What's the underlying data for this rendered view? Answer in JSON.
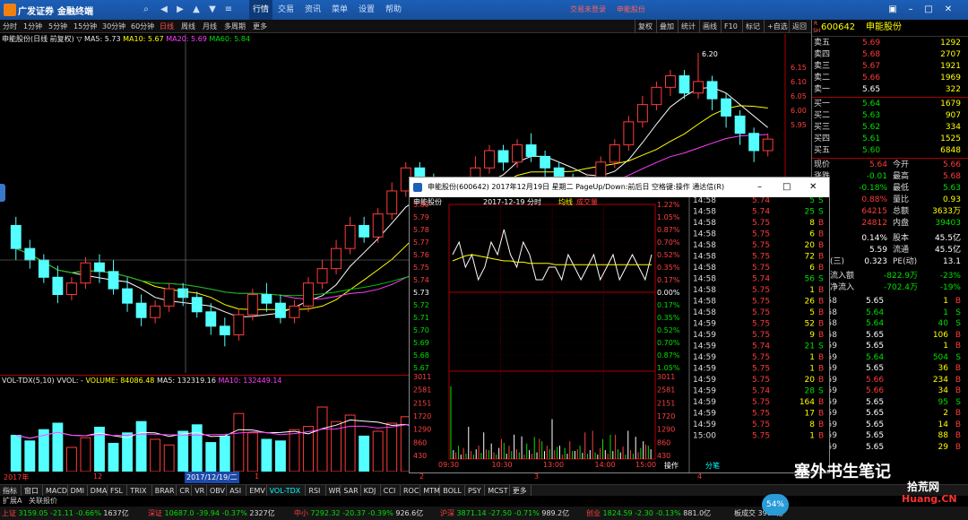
{
  "titlebar": {
    "brand": "广发证券",
    "subtitle": "金融终端",
    "menu": [
      "行情",
      "交易",
      "资讯",
      "菜单",
      "设置",
      "帮助"
    ],
    "active_menu": "行情",
    "login_msg": "交易未登录",
    "stock": "申能股份"
  },
  "periods": [
    "分时",
    "1分钟",
    "5分钟",
    "15分钟",
    "30分钟",
    "60分钟",
    "日线",
    "周线",
    "月线",
    "多周期",
    "更多"
  ],
  "selected_period": "日线",
  "right_tools": [
    "复权",
    "叠加",
    "统计",
    "画线",
    "F10",
    "标记",
    "+自选",
    "返回"
  ],
  "kline": {
    "title": "申能股份(日线 前复权)",
    "ma5": "MA5: 5.73",
    "ma10": "MA10: 5.67",
    "ma20": "MA20: 5.69",
    "ma60": "MA60: 5.84",
    "peak_label": "6.20",
    "price_ticks": [
      "6.15",
      "6.10",
      "6.05",
      "6.00",
      "5.95"
    ]
  },
  "volume": {
    "indicator": "VOL-TDX(5,10)",
    "vvol": "VVOL: -",
    "volume": "VOLUME: 84086.48",
    "ma5": "MA5: 132319.16",
    "ma10": "MA10: 132449.14"
  },
  "datebar": {
    "labels": [
      "2017年",
      "12",
      "2017/12/19/二",
      "1",
      "2",
      "3",
      "4"
    ]
  },
  "quote": {
    "code": "600642",
    "name": "申能股份",
    "tag_top": "R",
    "tag_bottom": "SH",
    "asks": [
      {
        "label": "卖五",
        "price": "5.69",
        "vol": "1292"
      },
      {
        "label": "卖四",
        "price": "5.68",
        "vol": "2707"
      },
      {
        "label": "卖三",
        "price": "5.67",
        "vol": "1921"
      },
      {
        "label": "卖二",
        "price": "5.66",
        "vol": "1969"
      },
      {
        "label": "卖一",
        "price": "5.65",
        "vol": "322"
      }
    ],
    "bids": [
      {
        "label": "买一",
        "price": "5.64",
        "vol": "1679"
      },
      {
        "label": "买二",
        "price": "5.63",
        "vol": "907"
      },
      {
        "label": "买三",
        "price": "5.62",
        "vol": "334"
      },
      {
        "label": "买四",
        "price": "5.61",
        "vol": "1525"
      },
      {
        "label": "买五",
        "price": "5.60",
        "vol": "6848"
      }
    ],
    "stats": [
      {
        "l1": "现价",
        "v1": "5.64",
        "l2": "今开",
        "v2": "5.66"
      },
      {
        "l1": "涨跌",
        "v1": "-0.01",
        "l2": "最高",
        "v2": "5.68"
      },
      {
        "l1": "涨幅",
        "v1": "-0.18%",
        "l2": "最低",
        "v2": "5.63"
      },
      {
        "l1": "振幅",
        "v1": "0.88%",
        "l2": "量比",
        "v2": "0.93"
      },
      {
        "l1": "总手",
        "v1": "64215",
        "l2": "总额",
        "v2": "3633万"
      },
      {
        "l1": "外盘",
        "v1": "24812",
        "l2": "内盘",
        "v2": "39403"
      }
    ],
    "stats2": [
      {
        "l1": "换手",
        "v1": "0.14%",
        "l2": "股本",
        "v2": "45.5亿"
      },
      {
        "l1": "净资",
        "v1": "5.59",
        "l2": "流通",
        "v2": "45.5亿"
      },
      {
        "l1": "收益(三)",
        "v1": "0.323",
        "l2": "PE(动)",
        "v2": "13.1"
      }
    ],
    "flows": [
      {
        "label": "主力流入额",
        "v": "-822.9万",
        "p": "-23%"
      },
      {
        "label": "主力净流入",
        "v": "-702.4万",
        "p": "-19%"
      }
    ],
    "ticks": [
      {
        "t": "14:58",
        "p": "5.65",
        "v": "1",
        "d": "B"
      },
      {
        "t": "14:58",
        "p": "5.64",
        "v": "1",
        "d": "S"
      },
      {
        "t": "14:58",
        "p": "5.64",
        "v": "40",
        "d": "S"
      },
      {
        "t": "14:58",
        "p": "5.65",
        "v": "106",
        "d": "B"
      },
      {
        "t": "14:59",
        "p": "5.65",
        "v": "1",
        "d": "B"
      },
      {
        "t": "14:59",
        "p": "5.64",
        "v": "504",
        "d": "S"
      },
      {
        "t": "14:59",
        "p": "5.65",
        "v": "36",
        "d": "B"
      },
      {
        "t": "14:59",
        "p": "5.66",
        "v": "234",
        "d": "B"
      },
      {
        "t": "14:59",
        "p": "5.66",
        "v": "34",
        "d": "B"
      },
      {
        "t": "14:59",
        "p": "5.65",
        "v": "95",
        "d": "S"
      },
      {
        "t": "14:59",
        "p": "5.65",
        "v": "2",
        "d": "B"
      },
      {
        "t": "14:59",
        "p": "5.65",
        "v": "14",
        "d": "B"
      },
      {
        "t": "14:59",
        "p": "5.65",
        "v": "88",
        "d": "B"
      },
      {
        "t": "14:59",
        "p": "5.65",
        "v": "29",
        "d": "B"
      }
    ]
  },
  "popup": {
    "title": "申能股份(600642) 2017年12月19日 星期二 PageUp/Down:前后日 空格键:操作 通达信(R)",
    "chart_title": "申能股份",
    "chart_date": "2017-12-19 分时",
    "legend_avg": "均线",
    "legend_vol": "成交量",
    "price_ticks": [
      "5.80",
      "5.79",
      "5.78",
      "5.77",
      "5.76",
      "5.75",
      "5.74",
      "5.73",
      "5.72",
      "5.71",
      "5.70",
      "5.69",
      "5.68",
      "5.67"
    ],
    "pct_ticks": [
      "1.22%",
      "1.05%",
      "0.87%",
      "0.70%",
      "0.52%",
      "0.35%",
      "0.17%",
      "0.00%",
      "0.17%",
      "0.35%",
      "0.52%",
      "0.70%",
      "0.87%",
      "1.05%"
    ],
    "vol_ticks": [
      "3011",
      "2581",
      "2151",
      "1720",
      "1290",
      "860",
      "430"
    ],
    "time_ticks": [
      "09:30",
      "10:30",
      "13:00",
      "14:00",
      "15:00"
    ],
    "bottom_buttons": [
      "操作",
      "分笔"
    ],
    "ticks": [
      {
        "t": "14:58",
        "p": "5.74",
        "v": "5",
        "d": "S"
      },
      {
        "t": "14:58",
        "p": "5.74",
        "v": "25",
        "d": "S"
      },
      {
        "t": "14:58",
        "p": "5.75",
        "v": "8",
        "d": "B"
      },
      {
        "t": "14:58",
        "p": "5.75",
        "v": "6",
        "d": "B"
      },
      {
        "t": "14:58",
        "p": "5.75",
        "v": "20",
        "d": "B"
      },
      {
        "t": "14:58",
        "p": "5.75",
        "v": "72",
        "d": "B"
      },
      {
        "t": "14:58",
        "p": "5.75",
        "v": "6",
        "d": "B"
      },
      {
        "t": "14:58",
        "p": "5.74",
        "v": "56",
        "d": "S"
      },
      {
        "t": "14:58",
        "p": "5.75",
        "v": "1",
        "d": "B"
      },
      {
        "t": "14:58",
        "p": "5.75",
        "v": "26",
        "d": "B"
      },
      {
        "t": "14:58",
        "p": "5.75",
        "v": "5",
        "d": "B"
      },
      {
        "t": "14:59",
        "p": "5.75",
        "v": "52",
        "d": "B"
      },
      {
        "t": "14:59",
        "p": "5.75",
        "v": "9",
        "d": "B"
      },
      {
        "t": "14:59",
        "p": "5.74",
        "v": "21",
        "d": "S"
      },
      {
        "t": "14:59",
        "p": "5.75",
        "v": "1",
        "d": "B"
      },
      {
        "t": "14:59",
        "p": "5.75",
        "v": "1",
        "d": "B"
      },
      {
        "t": "14:59",
        "p": "5.75",
        "v": "20",
        "d": "B"
      },
      {
        "t": "14:59",
        "p": "5.74",
        "v": "28",
        "d": "S"
      },
      {
        "t": "14:59",
        "p": "5.75",
        "v": "164",
        "d": "B"
      },
      {
        "t": "14:59",
        "p": "5.75",
        "v": "17",
        "d": "B"
      },
      {
        "t": "14:59",
        "p": "5.75",
        "v": "8",
        "d": "B"
      },
      {
        "t": "15:00",
        "p": "5.75",
        "v": "1",
        "d": "B"
      }
    ]
  },
  "tabs": [
    "指标",
    "窗口",
    "MACD",
    "DMI",
    "DMA",
    "FSL",
    "TRIX",
    "BRAR",
    "CR",
    "VR",
    "OBV",
    "ASI",
    "EMV",
    "VOL-TDX",
    "RSI",
    "WR",
    "SAR",
    "KDJ",
    "CCI",
    "ROC",
    "MTM",
    "BOLL",
    "PSY",
    "MCST",
    "更多"
  ],
  "selected_tab": "VOL-TDX",
  "expand": [
    "扩展A",
    "关联报价"
  ],
  "status": [
    {
      "name": "上证",
      "v": "3159.05",
      "c": "-21.11",
      "p": "-0.66%",
      "a": "1637亿"
    },
    {
      "name": "深证",
      "v": "10687.0",
      "c": "-39.94",
      "p": "-0.37%",
      "a": "2327亿"
    },
    {
      "name": "中小",
      "v": "7292.32",
      "c": "-20.37",
      "p": "-0.39%",
      "a": "926.6亿"
    },
    {
      "name": "沪深",
      "v": "3871.14",
      "c": "-27.50",
      "p": "-0.71%",
      "a": "989.2亿"
    },
    {
      "name": "创业",
      "v": "1824.59",
      "c": "-2.30",
      "p": "-0.13%",
      "a": "881.0亿"
    }
  ],
  "status_tail": {
    "label": "板成交",
    "value": "3964亿",
    "badge": "54%"
  },
  "watermark": {
    "line1": "塞外书生笔记",
    "line2": "拾荒网",
    "line3": "Huang.CN"
  },
  "popup_chart_data": {
    "type": "line",
    "x": [
      "09:30",
      "10:30",
      "13:00",
      "14:00",
      "15:00"
    ],
    "series": [
      {
        "values": [
          5.76,
          5.77,
          5.75,
          5.76,
          5.74,
          5.75,
          5.77,
          5.76,
          5.78,
          5.76,
          5.75,
          5.77,
          5.76,
          5.74,
          5.74,
          5.75,
          5.75,
          5.74,
          5.76,
          5.75,
          5.74,
          5.75,
          5.76,
          5.74,
          5.75,
          5.76,
          5.74,
          5.75,
          5.76,
          5.75,
          5.74,
          5.76
        ]
      },
      {
        "values": [
          5.755,
          5.757,
          5.759,
          5.76,
          5.759,
          5.758,
          5.757,
          5.756,
          5.755,
          5.755,
          5.754,
          5.754,
          5.753,
          5.753,
          5.753,
          5.753,
          5.752,
          5.752,
          5.752,
          5.752,
          5.752,
          5.752,
          5.752,
          5.752,
          5.752,
          5.752,
          5.752,
          5.752,
          5.752,
          5.752,
          5.752,
          5.752
        ]
      }
    ],
    "ylim": [
      5.67,
      5.8
    ],
    "base": 5.73
  },
  "chart_data": {
    "type": "candlestick",
    "ylim": [
      5.1,
      6.24
    ],
    "candles": [
      [
        5.6,
        5.52,
        5.63,
        5.48
      ],
      [
        5.52,
        5.48,
        5.55,
        5.45
      ],
      [
        5.48,
        5.42,
        5.5,
        5.4
      ],
      [
        5.42,
        5.36,
        5.46,
        5.33
      ],
      [
        5.36,
        5.4,
        5.42,
        5.34
      ],
      [
        5.4,
        5.47,
        5.49,
        5.38
      ],
      [
        5.47,
        5.44,
        5.5,
        5.4
      ],
      [
        5.44,
        5.38,
        5.48,
        5.36
      ],
      [
        5.38,
        5.33,
        5.42,
        5.3
      ],
      [
        5.33,
        5.28,
        5.36,
        5.25
      ],
      [
        5.28,
        5.32,
        5.34,
        5.26
      ],
      [
        5.32,
        5.38,
        5.4,
        5.3
      ],
      [
        5.38,
        5.35,
        5.4,
        5.32
      ],
      [
        5.35,
        5.3,
        5.37,
        5.28
      ],
      [
        5.3,
        5.25,
        5.33,
        5.22
      ],
      [
        5.25,
        5.22,
        5.28,
        5.18
      ],
      [
        5.22,
        5.29,
        5.31,
        5.2
      ],
      [
        5.29,
        5.36,
        5.38,
        5.27
      ],
      [
        5.36,
        5.33,
        5.4,
        5.3
      ],
      [
        5.33,
        5.28,
        5.36,
        5.26
      ],
      [
        5.28,
        5.32,
        5.34,
        5.26
      ],
      [
        5.32,
        5.4,
        5.42,
        5.3
      ],
      [
        5.4,
        5.45,
        5.48,
        5.38
      ],
      [
        5.45,
        5.52,
        5.55,
        5.43
      ],
      [
        5.52,
        5.6,
        5.63,
        5.5
      ],
      [
        5.6,
        5.56,
        5.63,
        5.54
      ],
      [
        5.56,
        5.64,
        5.66,
        5.54
      ],
      [
        5.64,
        5.72,
        5.75,
        5.62
      ],
      [
        5.72,
        5.8,
        5.82,
        5.7
      ],
      [
        5.8,
        5.76,
        5.82,
        5.72
      ],
      [
        5.76,
        5.7,
        5.78,
        5.66
      ],
      [
        5.7,
        5.66,
        5.73,
        5.64
      ],
      [
        5.66,
        5.74,
        5.76,
        5.64
      ],
      [
        5.74,
        5.8,
        5.84,
        5.72
      ],
      [
        5.8,
        5.86,
        5.88,
        5.78
      ],
      [
        5.86,
        5.82,
        5.88,
        5.79
      ],
      [
        5.82,
        5.88,
        5.9,
        5.8
      ],
      [
        5.88,
        5.84,
        5.92,
        5.82
      ],
      [
        5.84,
        5.8,
        5.86,
        5.76
      ],
      [
        5.8,
        5.76,
        5.82,
        5.72
      ],
      [
        5.76,
        5.72,
        5.78,
        5.68
      ],
      [
        5.72,
        5.76,
        5.78,
        5.7
      ],
      [
        5.76,
        5.82,
        5.84,
        5.74
      ],
      [
        5.82,
        5.88,
        5.9,
        5.8
      ],
      [
        5.88,
        5.96,
        5.98,
        5.86
      ],
      [
        5.96,
        6.02,
        6.05,
        5.94
      ],
      [
        6.02,
        6.08,
        6.1,
        6.0
      ],
      [
        6.08,
        6.12,
        6.14,
        6.05
      ],
      [
        6.12,
        6.06,
        6.14,
        6.04
      ],
      [
        6.06,
        6.1,
        6.2,
        6.04
      ],
      [
        6.1,
        6.04,
        6.12,
        6.0
      ],
      [
        6.04,
        5.98,
        6.06,
        5.94
      ],
      [
        5.98,
        5.92,
        6.0,
        5.88
      ],
      [
        5.92,
        5.86,
        5.94,
        5.82
      ],
      [
        5.86,
        5.9,
        5.92,
        5.84
      ]
    ]
  }
}
